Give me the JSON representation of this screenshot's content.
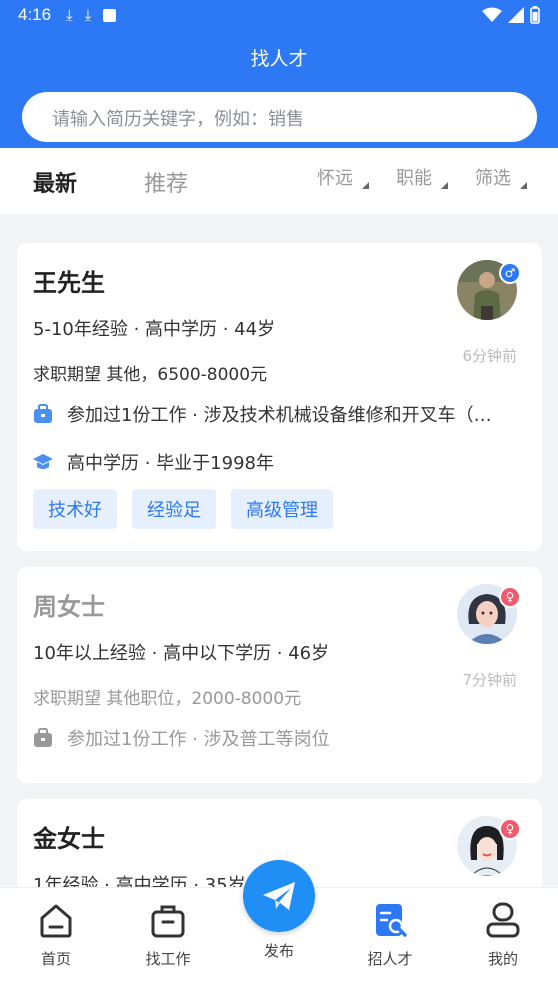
{
  "status": {
    "time": "4:16"
  },
  "header": {
    "title": "找人才"
  },
  "search": {
    "placeholder": "请输入简历关键字，例如：销售"
  },
  "tabs": {
    "latest": "最新",
    "recommend": "推荐"
  },
  "filters": {
    "location": "怀远",
    "function": "职能",
    "screen": "筛选"
  },
  "colors": {
    "primary": "#2d78f4",
    "male": "#2d78f4",
    "female": "#f05a6e"
  },
  "candidates": [
    {
      "name": "王先生",
      "gender": "male",
      "meta": "5-10年经验 · 高中学历 · 44岁",
      "expectation": "求职期望 其他，6500-8000元",
      "time": "6分钟前",
      "work": "参加过1份工作 · 涉及技术机械设备维修和开叉车（…",
      "education": "高中学历 · 毕业于1998年",
      "tags": [
        "技术好",
        "经验足",
        "高级管理"
      ]
    },
    {
      "name": "周女士",
      "gender": "female",
      "meta": "10年以上经验 · 高中以下学历 · 46岁",
      "expectation": "求职期望 其他职位，2000-8000元",
      "time": "7分钟前",
      "work": "参加过1份工作 · 涉及普工等岗位"
    },
    {
      "name": "金女士",
      "gender": "female",
      "meta": "1年经验 · 高中学历 · 35岁"
    }
  ],
  "nav": {
    "home": "首页",
    "jobs": "找工作",
    "publish": "发布",
    "talent": "招人才",
    "mine": "我的"
  }
}
